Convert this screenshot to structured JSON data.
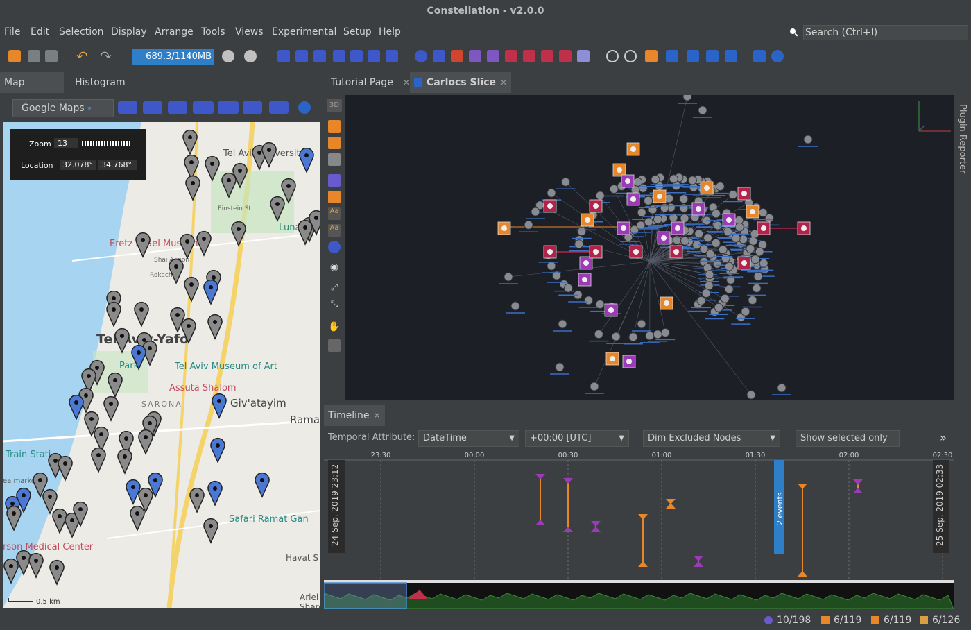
{
  "app": {
    "title": "Constellation - v2.0.0"
  },
  "menu": [
    "File",
    "Edit",
    "Selection",
    "Display",
    "Arrange",
    "Tools",
    "Views",
    "Experimental",
    "Setup",
    "Help"
  ],
  "search": {
    "placeholder": "Search (Ctrl+I)"
  },
  "toolbar": {
    "memory": "689.3/1140MB",
    "memory_fraction": 0.6
  },
  "left_tabs": [
    {
      "label": "Map View"
    },
    {
      "label": "Histogram"
    }
  ],
  "map": {
    "provider": "Google Maps",
    "zoom_label": "Zoom",
    "zoom_value": "13",
    "location_label": "Location",
    "lat": "32.078°",
    "lon": "34.768°",
    "scale": "0.5 km",
    "places": [
      "Tel Aviv University",
      "Eretz Israel Museum",
      "Tel Aviv-Yafo",
      "Tel Aviv Museum of Art",
      "Assuta Shalom",
      "Giv'atayim",
      "Rama",
      "SARONA",
      "Train Stati",
      "Safari Ramat Gan",
      "rson Medical Center",
      "Havat S",
      "Ariel Sharon",
      "Luna",
      "Einstein St",
      "Rokach Bl",
      "Shai Agnon",
      "Park",
      "ea marke"
    ]
  },
  "right_tabs": [
    {
      "label": "Tutorial Page"
    },
    {
      "label": "Carlocs Slice"
    }
  ],
  "graph": {
    "mode_label": "3D",
    "side_label": "Plugin Reporter"
  },
  "timeline": {
    "tab": "Timeline",
    "temporal_attribute_label": "Temporal Attribute:",
    "attribute": "DateTime",
    "timezone": "+00:00 [UTC]",
    "exclusion": "Dim Excluded Nodes",
    "selected_only": "Show selected only",
    "ticks": [
      "23:30",
      "00:00",
      "00:30",
      "01:00",
      "01:30",
      "02:00",
      "02:30"
    ],
    "start_label": "24 Sep. 2019  23:12",
    "end_label": "25 Sep. 2019  02:33",
    "cluster_label": "2 events"
  },
  "status": {
    "nodes": "10/198",
    "transactions": "6/119",
    "edges": "6/119",
    "links": "6/126"
  },
  "colors": {
    "accent": "#2e7fc7",
    "orange": "#e8862a",
    "purple": "#9b3bb5",
    "red": "#b0234a",
    "map_bg": "#e8e6e1",
    "graph_bg": "#1c1f26"
  }
}
